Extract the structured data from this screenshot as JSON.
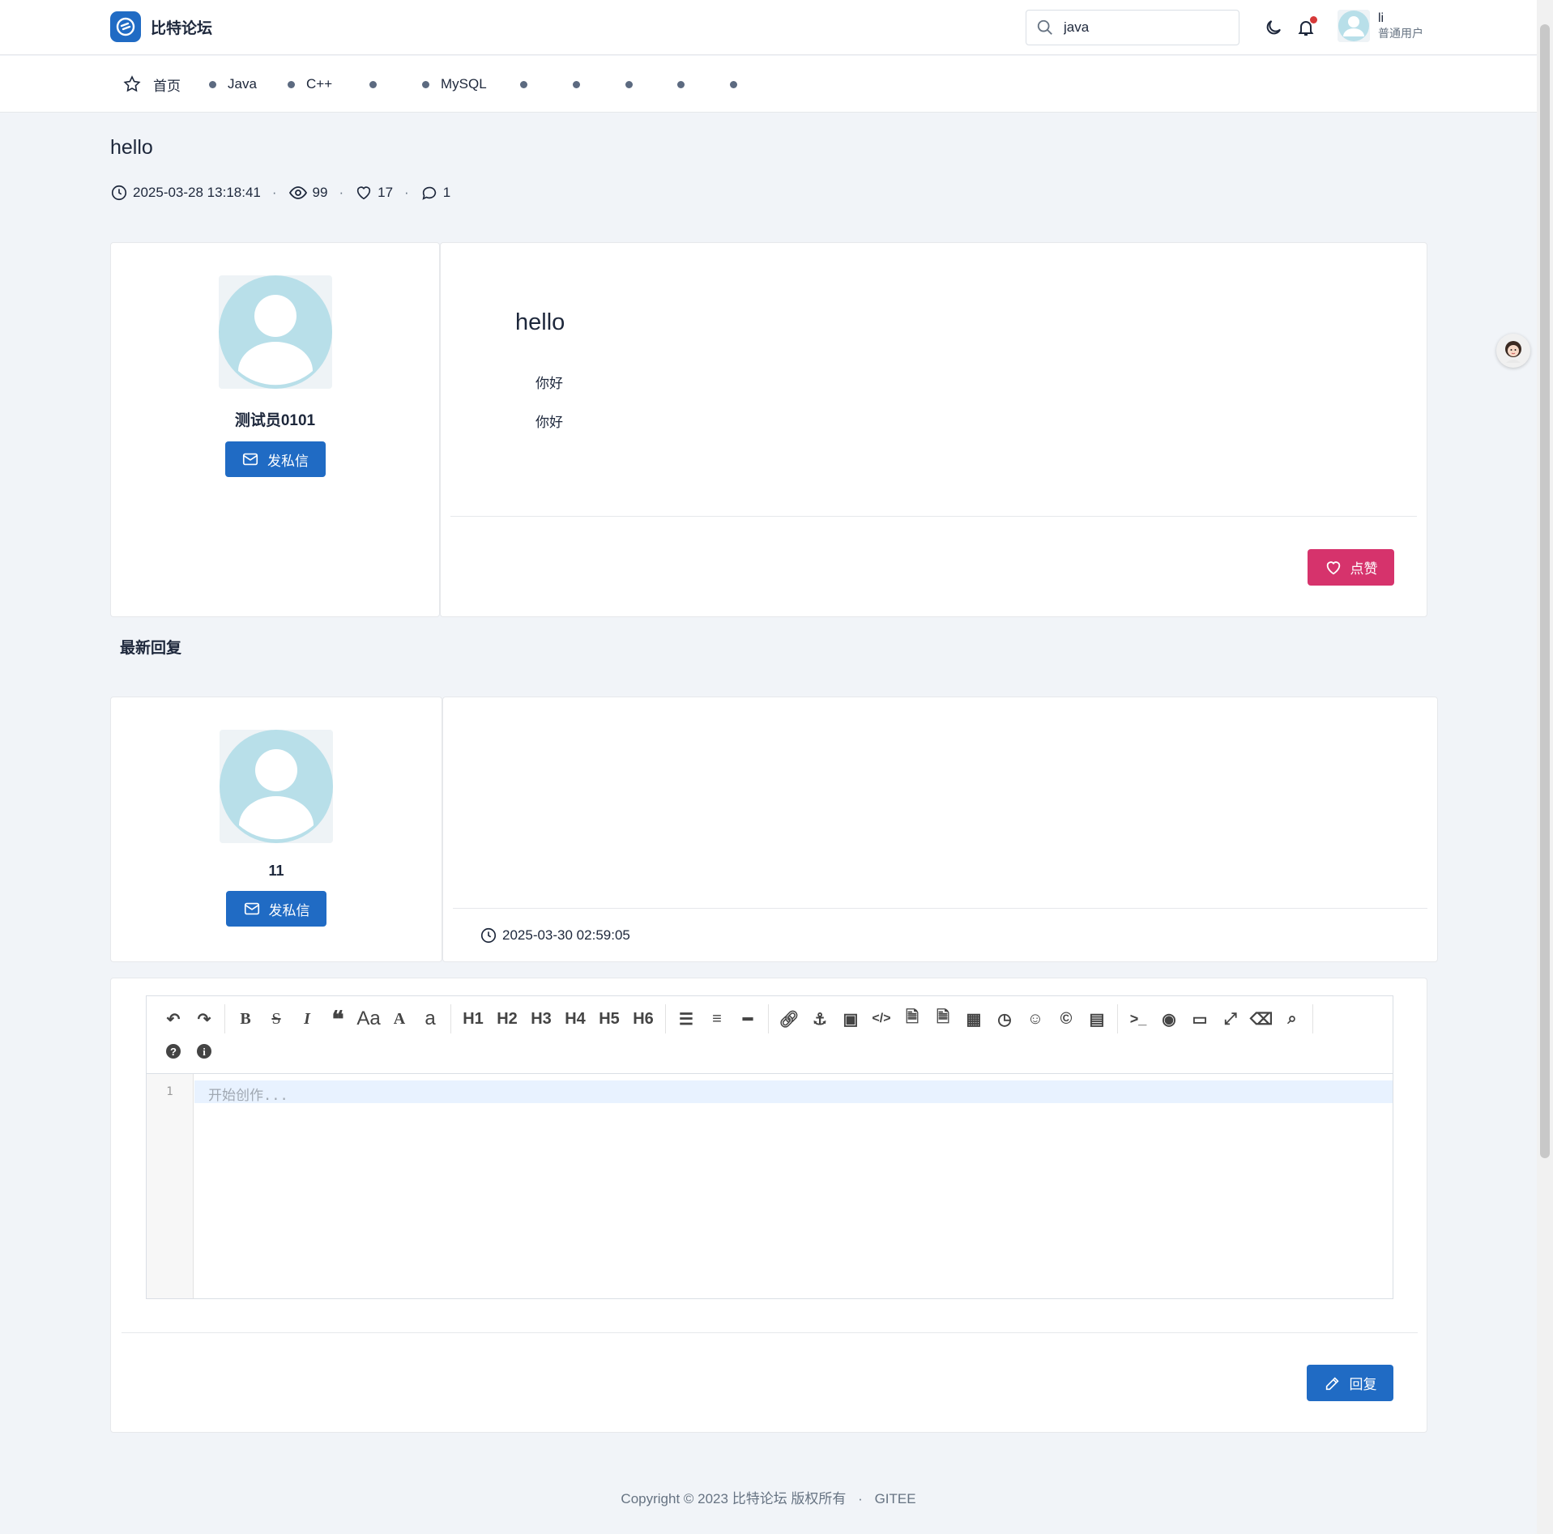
{
  "brand": {
    "name": "比特论坛"
  },
  "search": {
    "value": "java"
  },
  "user": {
    "name": "li",
    "role": "普通用户"
  },
  "nav": {
    "items": [
      {
        "label": "首页"
      },
      {
        "label": "Java"
      },
      {
        "label": "C++"
      },
      {
        "label": ""
      },
      {
        "label": "MySQL"
      },
      {
        "label": ""
      },
      {
        "label": ""
      },
      {
        "label": ""
      },
      {
        "label": ""
      },
      {
        "label": ""
      }
    ]
  },
  "article": {
    "title": "hello",
    "datetime": "2025-03-28 13:18:41",
    "views": "99",
    "likes": "17",
    "comments": "1",
    "author": {
      "name": "测试员0101",
      "message_label": "发私信"
    },
    "body": {
      "heading": "hello",
      "paragraphs": [
        "你好",
        "你好"
      ]
    },
    "like_label": "点赞"
  },
  "replies": {
    "section_label": "最新回复",
    "items": [
      {
        "author": {
          "name": "11",
          "message_label": "发私信"
        },
        "content": "",
        "datetime": "2025-03-30 02:59:05"
      }
    ]
  },
  "editor": {
    "line_number": "1",
    "placeholder": "开始创作...",
    "heading_buttons": [
      "H1",
      "H2",
      "H3",
      "H4",
      "H5",
      "H6"
    ],
    "submit_label": "回复"
  },
  "footer": {
    "copyright": "Copyright © 2023 比特论坛 版权所有",
    "separator": "·",
    "link": "GITEE"
  },
  "colors": {
    "primary": "#206bc4",
    "like": "#d6336c",
    "page_bg": "#f1f4f8",
    "notif_dot": "#d63939"
  }
}
